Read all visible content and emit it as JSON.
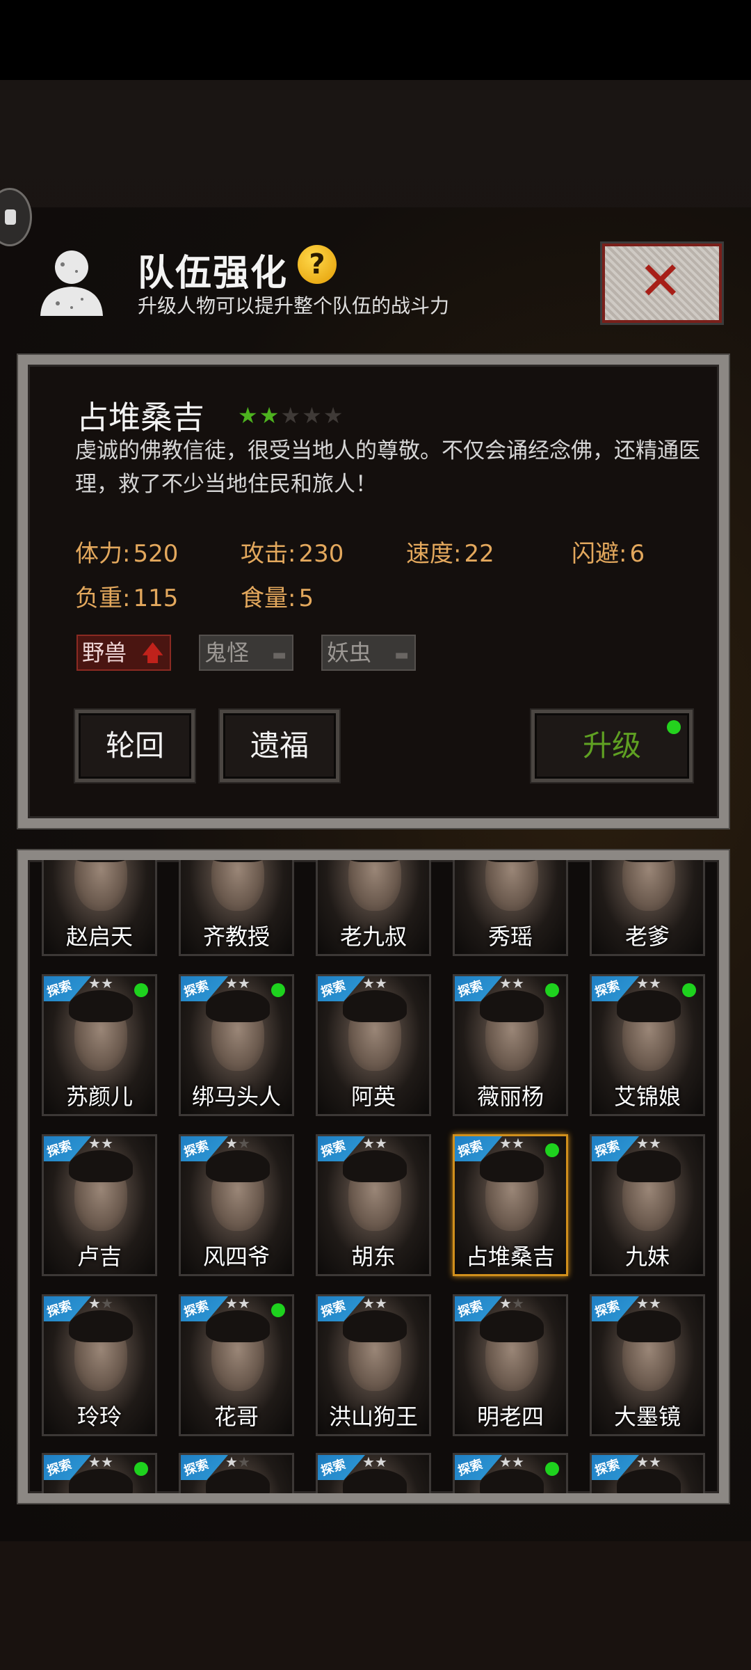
{
  "header": {
    "title": "队伍强化",
    "help_symbol": "?",
    "subtitle": "升级人物可以提升整个队伍的战斗力",
    "close_symbol": "✕"
  },
  "detail": {
    "name": "占堆桑吉",
    "stars_total": 5,
    "stars_filled": 2,
    "description": "虔诚的佛教信徒，很受当地人的尊敬。不仅会诵经念佛，还精通医理，救了不少当地住民和旅人！",
    "stats": [
      {
        "label": "体力:",
        "value": "520"
      },
      {
        "label": "攻击:",
        "value": "230"
      },
      {
        "label": "速度:",
        "value": "22"
      },
      {
        "label": "闪避:",
        "value": "6"
      },
      {
        "label": "负重:",
        "value": "115"
      },
      {
        "label": "食量:",
        "value": "5"
      }
    ],
    "tags": [
      {
        "label": "野兽",
        "active": true
      },
      {
        "label": "鬼怪",
        "active": false
      },
      {
        "label": "妖虫",
        "active": false
      }
    ],
    "buttons": {
      "reincarnate": "轮回",
      "legacy": "遗福",
      "upgrade": "升级"
    }
  },
  "roster": {
    "badge_label": "探索",
    "rows": [
      [
        {
          "name": "赵启天",
          "stars": 0,
          "badge": false,
          "dot": false,
          "partial": true
        },
        {
          "name": "齐教授",
          "stars": 0,
          "badge": false,
          "dot": false,
          "partial": true
        },
        {
          "name": "老九叔",
          "stars": 0,
          "badge": false,
          "dot": false,
          "partial": true
        },
        {
          "name": "秀瑶",
          "stars": 0,
          "badge": false,
          "dot": false,
          "partial": true
        },
        {
          "name": "老爹",
          "stars": 0,
          "badge": false,
          "dot": false,
          "partial": true
        }
      ],
      [
        {
          "name": "苏颜儿",
          "stars": 2,
          "badge": true,
          "dot": true
        },
        {
          "name": "绑马头人",
          "stars": 2,
          "badge": true,
          "dot": true
        },
        {
          "name": "阿英",
          "stars": 2,
          "badge": true,
          "dot": false
        },
        {
          "name": "薇丽杨",
          "stars": 2,
          "badge": true,
          "dot": true
        },
        {
          "name": "艾锦娘",
          "stars": 2,
          "badge": true,
          "dot": true
        }
      ],
      [
        {
          "name": "卢吉",
          "stars": 2,
          "badge": true,
          "dot": false
        },
        {
          "name": "风四爷",
          "stars": 1,
          "badge": true,
          "dot": false
        },
        {
          "name": "胡东",
          "stars": 2,
          "badge": true,
          "dot": false
        },
        {
          "name": "占堆桑吉",
          "stars": 2,
          "badge": true,
          "dot": true,
          "selected": true
        },
        {
          "name": "九妹",
          "stars": 2,
          "badge": true,
          "dot": false
        }
      ],
      [
        {
          "name": "玲玲",
          "stars": 1,
          "badge": true,
          "dot": false
        },
        {
          "name": "花哥",
          "stars": 2,
          "badge": true,
          "dot": true
        },
        {
          "name": "洪山狗王",
          "stars": 2,
          "badge": true,
          "dot": false
        },
        {
          "name": "明老四",
          "stars": 1,
          "badge": true,
          "dot": false
        },
        {
          "name": "大墨镜",
          "stars": 2,
          "badge": true,
          "dot": false
        }
      ],
      [
        {
          "name": "",
          "stars": 2,
          "badge": true,
          "dot": true,
          "partial": true
        },
        {
          "name": "",
          "stars": 1,
          "badge": true,
          "dot": false,
          "partial": true
        },
        {
          "name": "",
          "stars": 2,
          "badge": true,
          "dot": false,
          "partial": true
        },
        {
          "name": "",
          "stars": 2,
          "badge": true,
          "dot": true,
          "partial": true
        },
        {
          "name": "",
          "stars": 2,
          "badge": true,
          "dot": false,
          "partial": true
        }
      ]
    ]
  }
}
